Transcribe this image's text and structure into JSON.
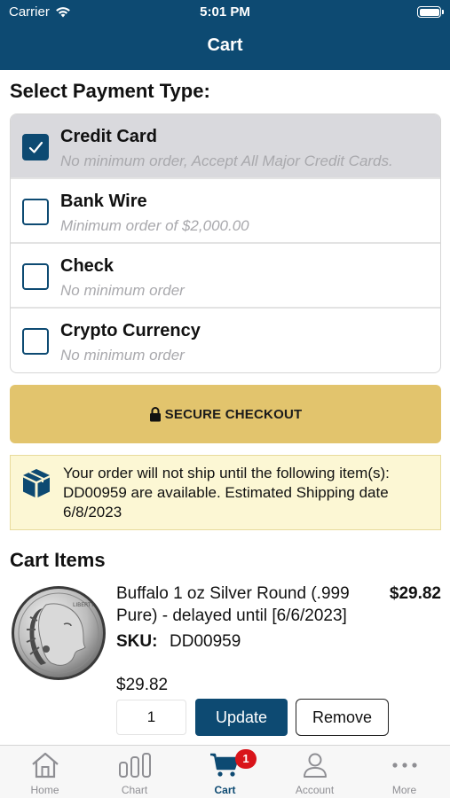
{
  "status_bar": {
    "carrier": "Carrier",
    "time": "5:01 PM"
  },
  "nav": {
    "title": "Cart"
  },
  "payment": {
    "heading": "Select Payment Type:",
    "options": [
      {
        "name": "Credit Card",
        "description": "No minimum order, Accept All Major Credit Cards.",
        "selected": true
      },
      {
        "name": "Bank Wire",
        "description": "Minimum order of $2,000.00",
        "selected": false
      },
      {
        "name": "Check",
        "description": "No minimum order",
        "selected": false
      },
      {
        "name": "Crypto Currency",
        "description": "No minimum order",
        "selected": false
      }
    ]
  },
  "checkout": {
    "label": "SECURE CHECKOUT",
    "icon": "lock-icon"
  },
  "notice": {
    "icon": "package-box-icon",
    "text": "Your order will not ship until the following item(s): DD00959 are available. Estimated Shipping date 6/8/2023"
  },
  "cart": {
    "heading": "Cart Items",
    "items": [
      {
        "image": "buffalo-silver-coin",
        "name": "Buffalo 1 oz Silver Round (.999 Pure) - delayed until [6/6/2023]",
        "price": "$29.82",
        "sku_label": "SKU:",
        "sku": "DD00959",
        "subtotal": "$29.82",
        "quantity": "1",
        "update_label": "Update",
        "remove_label": "Remove"
      }
    ]
  },
  "tabbar": {
    "tabs": [
      {
        "label": "Home",
        "icon": "home-icon",
        "active": false
      },
      {
        "label": "Chart",
        "icon": "bar-chart-icon",
        "active": false
      },
      {
        "label": "Cart",
        "icon": "cart-icon",
        "active": true,
        "badge": "1"
      },
      {
        "label": "Account",
        "icon": "person-icon",
        "active": false
      },
      {
        "label": "More",
        "icon": "ellipsis-icon",
        "active": false
      }
    ]
  },
  "colors": {
    "brand": "#0d4a72",
    "checkout": "#e2c46d",
    "notice_bg": "#fcf7d4",
    "badge": "#d9141a"
  }
}
